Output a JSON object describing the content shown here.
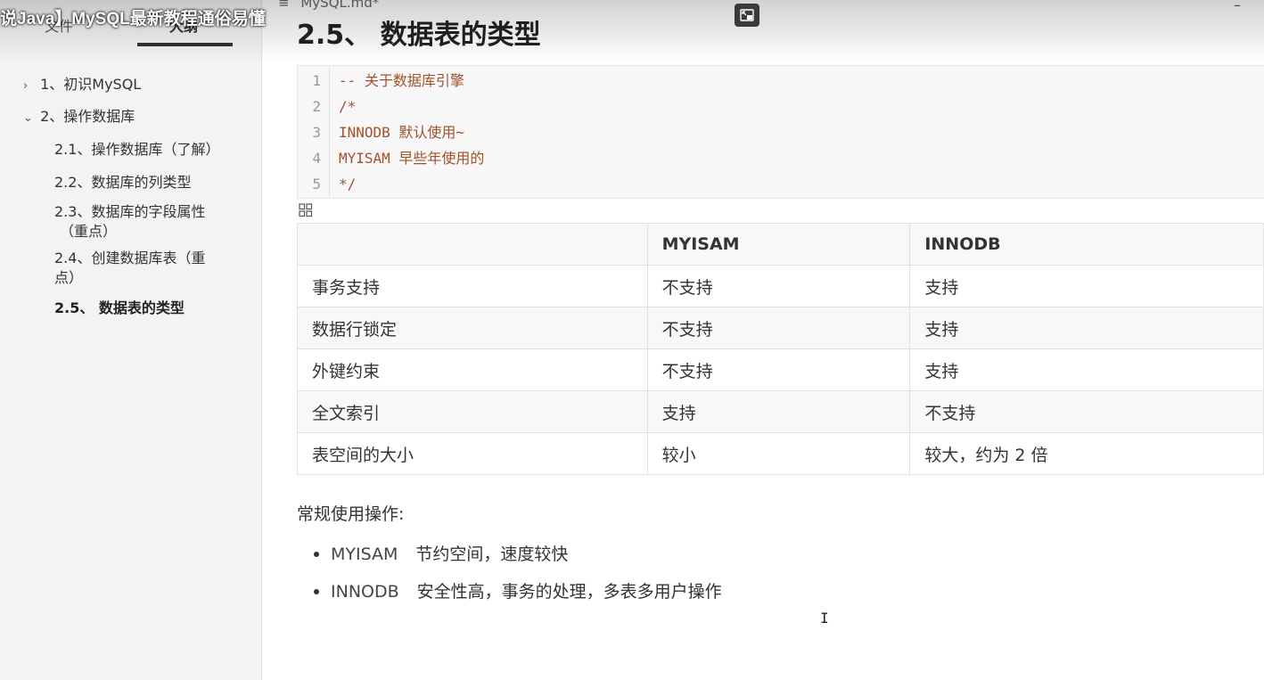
{
  "overlay": {
    "video_title": "说Java】MySQL最新教程通俗易懂"
  },
  "window": {
    "doc_tab": "MySQL.md*",
    "minimize": "–"
  },
  "sidebar": {
    "tabs": [
      {
        "label": "文件"
      },
      {
        "label": "大纲"
      }
    ],
    "outline": [
      {
        "label": "1、初识MySQL",
        "arrow": "›"
      },
      {
        "label": "2、操作数据库",
        "arrow": "⌄"
      },
      {
        "label": "2.1、操作数据库（了解）"
      },
      {
        "label": "2.2、数据库的列类型"
      },
      {
        "label": "2.3、数据库的字段属性",
        "label2": "（重点）"
      },
      {
        "label": "2.4、创建数据库表（重",
        "label2": "点）"
      },
      {
        "label": "2.5、 数据表的类型"
      }
    ]
  },
  "main": {
    "title": "2.5、 数据表的类型",
    "code": [
      {
        "n": "1",
        "text": "-- 关于数据库引擎"
      },
      {
        "n": "2",
        "text": "/*"
      },
      {
        "n": "3",
        "kw": "INNODB",
        "text": " 默认使用~"
      },
      {
        "n": "4",
        "kw": "MYISAM",
        "text": " 早些年使用的"
      },
      {
        "n": "5",
        "text": "*/"
      }
    ],
    "table": {
      "headers": [
        "",
        "MYISAM",
        "INNODB"
      ],
      "rows": [
        [
          "事务支持",
          "不支持",
          "支持"
        ],
        [
          "数据行锁定",
          "不支持",
          "支持"
        ],
        [
          "外键约束",
          "不支持",
          "支持"
        ],
        [
          "全文索引",
          "支持",
          "不支持"
        ],
        [
          "表空间的大小",
          "较小",
          "较大，约为 2 倍"
        ]
      ]
    },
    "section_label": "常规使用操作:",
    "bullets": [
      {
        "term": "MYISAM",
        "desc": "节约空间，速度较快"
      },
      {
        "term": "INNODB",
        "desc": "安全性高，事务的处理，多表多用户操作"
      }
    ],
    "cursor": "I"
  }
}
